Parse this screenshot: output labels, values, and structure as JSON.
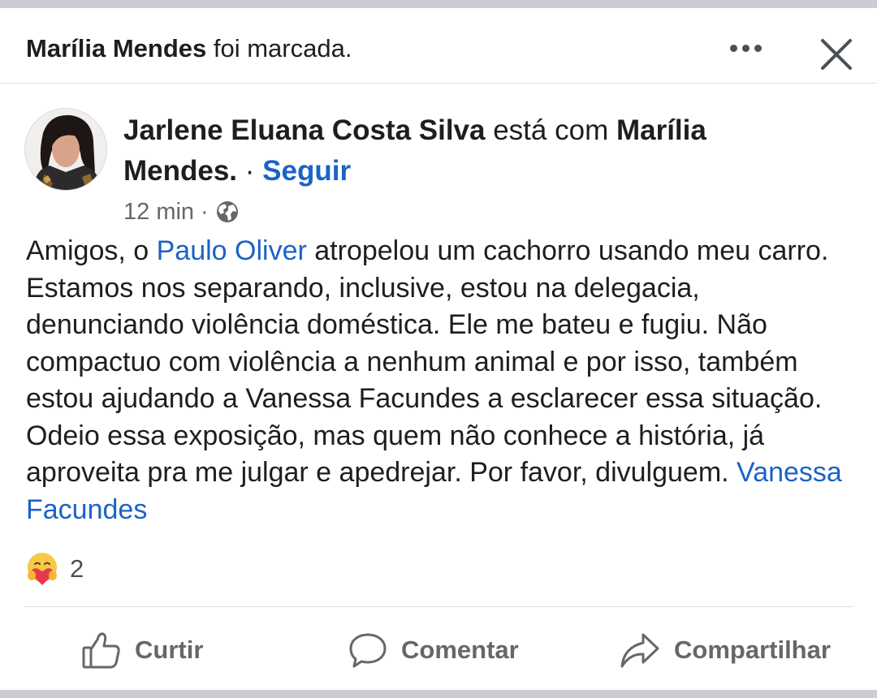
{
  "header": {
    "tagged_name": "Marília Mendes",
    "tagged_suffix": "foi marcada.",
    "more_icon": "ellipsis-icon",
    "close_icon": "close-icon"
  },
  "post": {
    "author": "Jarlene Eluana Costa Silva",
    "with_text": "está com",
    "with_name_line1": "Marília",
    "with_name_line2": "Mendes.",
    "dot_sep": "·",
    "follow_label": "Seguir",
    "time": "12 min",
    "meta_sep": "·",
    "privacy_icon": "globe-icon",
    "body": {
      "p1": "Amigos, o ",
      "mention1": "Paulo Oliver",
      "p2": " atropelou um cachorro usando meu carro. Estamos nos separando, inclusive, estou na delegacia, denunciando violência doméstica. Ele me bateu e fugiu. Não compactuo com violência a nenhum animal e por isso, também estou ajudando a Vanessa Facundes a esclarecer essa situação. Odeio essa exposição, mas quem não conhece a história, já aproveita pra me julgar e apedrejar. Por favor, divulguem. ",
      "mention2": "Vanessa Facundes"
    }
  },
  "reactions": {
    "icon": "care-reaction-icon",
    "count": "2"
  },
  "actions": {
    "like": "Curtir",
    "comment": "Comentar",
    "share": "Compartilhar"
  },
  "colors": {
    "link": "#1b63c6",
    "text": "#1c1e21",
    "secondary": "#65676b",
    "divider": "#dcdde1"
  }
}
